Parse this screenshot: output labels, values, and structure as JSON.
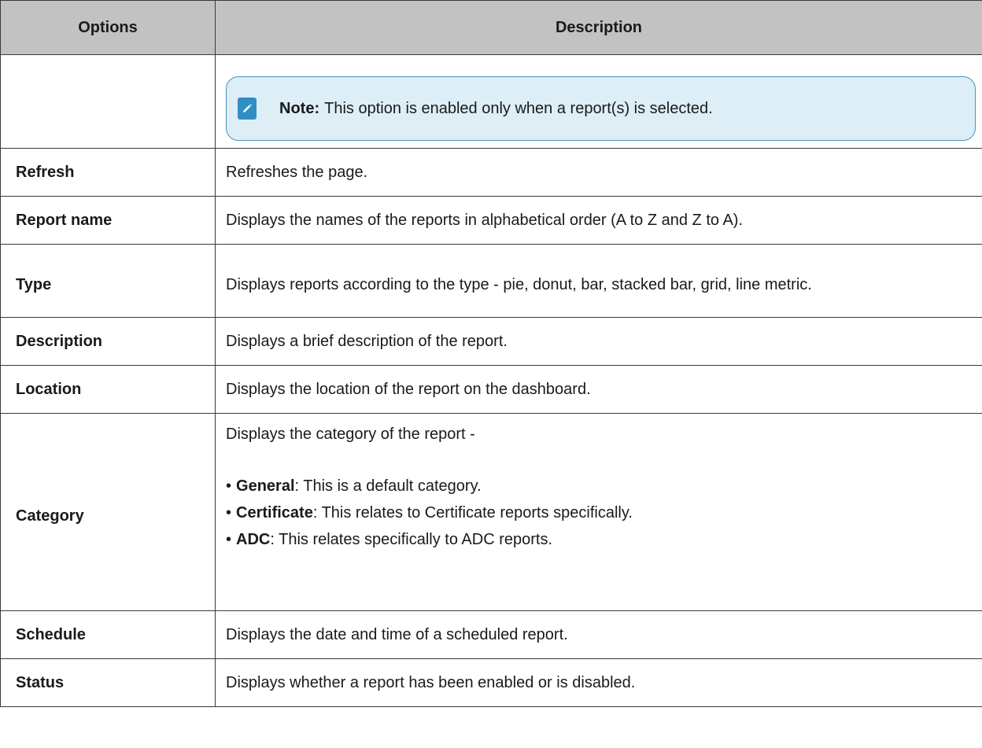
{
  "table": {
    "headers": {
      "options": "Options",
      "description": "Description"
    },
    "note": {
      "icon": "pencil-edit-icon",
      "label": "Note:",
      "text": "This option is enabled only when a report(s) is selected."
    },
    "rows": [
      {
        "option": "Refresh",
        "description": "Refreshes the page."
      },
      {
        "option": "Report name",
        "description": "Displays the names of the reports in alphabetical order (A to Z and Z to A)."
      },
      {
        "option": "Type",
        "description": "Displays reports according to the type - pie, donut, bar, stacked bar, grid, line metric."
      },
      {
        "option": "Description",
        "description": "Displays a brief description of the report."
      },
      {
        "option": "Location",
        "description": "Displays the location of the report on the dashboard."
      },
      {
        "option": "Category",
        "description": "Displays the category of the report -"
      },
      {
        "option": "Schedule",
        "description": "Displays the date and time of a scheduled report."
      },
      {
        "option": "Status",
        "description": "Displays whether a report has been enabled or is disabled."
      }
    ],
    "category_items": [
      {
        "bullet": "•",
        "term": "General",
        "text": ": This is a default category."
      },
      {
        "bullet": "•",
        "term": "Certificate",
        "text": ": This relates to Certificate reports specifically."
      },
      {
        "bullet": "•",
        "term": "ADC",
        "text": ": This relates specifically to ADC reports."
      }
    ]
  },
  "colors": {
    "header_bg": "#c2c2c2",
    "note_bg": "#ddeef7",
    "note_border": "#4a94b9",
    "note_icon": "#2f8fc4"
  }
}
